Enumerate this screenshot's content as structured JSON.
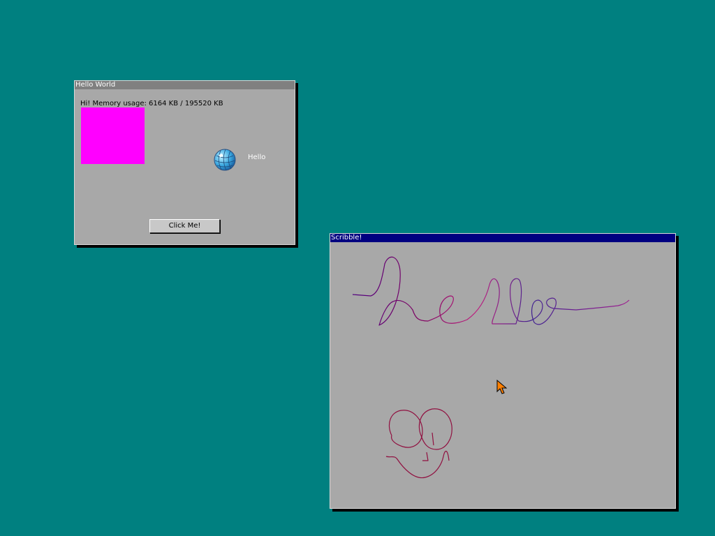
{
  "desktop": {
    "background": "#008080"
  },
  "hello_window": {
    "title": "Hello World",
    "greeting": "Hi!  Memory usage: 6164 KB / 195520 KB",
    "swatch_color": "#ff00ff",
    "globe_icon": "globe-icon",
    "label": "Hello",
    "button_label": "Click Me!"
  },
  "scribble_window": {
    "title": "Scribble!",
    "strokes": [
      "word-hello",
      "face-drawing"
    ]
  },
  "cursor": {
    "icon": "arrow-cursor-icon",
    "color": "#ff8000"
  }
}
